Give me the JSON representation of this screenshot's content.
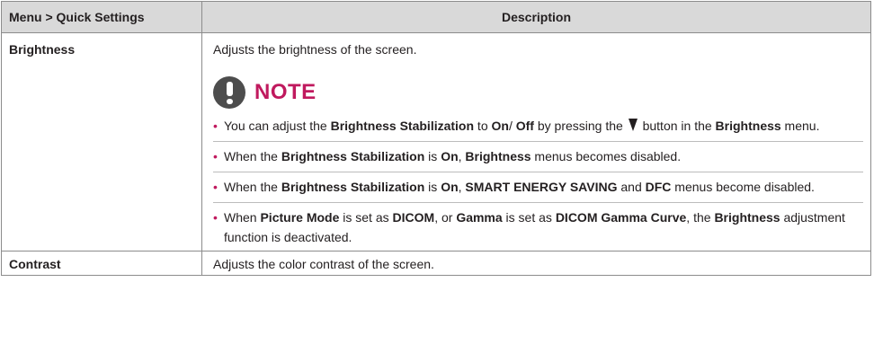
{
  "header": {
    "col1": "Menu > Quick Settings",
    "col2": "Description"
  },
  "rows": [
    {
      "label": "Brightness",
      "description": "Adjusts the brightness of the screen."
    },
    {
      "label": "Contrast",
      "description": "Adjusts the color contrast of the screen."
    }
  ],
  "note": {
    "title": "NOTE",
    "icon": "exclamation-circle-icon",
    "accent_color": "#c0195e",
    "items": [
      {
        "t1": "You can adjust the ",
        "b1": "Brightness Stabilization",
        "t2": " to ",
        "b2": "On",
        "t3": "/ ",
        "b3": "Off",
        "t4": " by pressing the ",
        "button_icon": "down-triangle-icon",
        "t5": " button in the ",
        "b4": "Brightness",
        "t6": " menu."
      },
      {
        "t1": "When the ",
        "b1": "Brightness Stabilization",
        "t2": " is ",
        "b2": "On",
        "t3": ", ",
        "b3": "Brightness",
        "t4": " menus becomes disabled."
      },
      {
        "t1": "When the ",
        "b1": "Brightness Stabilization",
        "t2": " is ",
        "b2": "On",
        "t3": ", ",
        "b3": "SMART ENERGY SAVING",
        "t4": " and ",
        "b4": "DFC",
        "t5": " menus become disabled."
      },
      {
        "t1": "When ",
        "b1": "Picture Mode",
        "t2": " is set as ",
        "b2": "DICOM",
        "t3": ", or ",
        "b3": "Gamma",
        "t4": " is set as ",
        "b4": "DICOM Gamma Curve",
        "t5": ", the ",
        "b5": "Brightness",
        "t6": " adjustment function is deactivated."
      }
    ]
  }
}
